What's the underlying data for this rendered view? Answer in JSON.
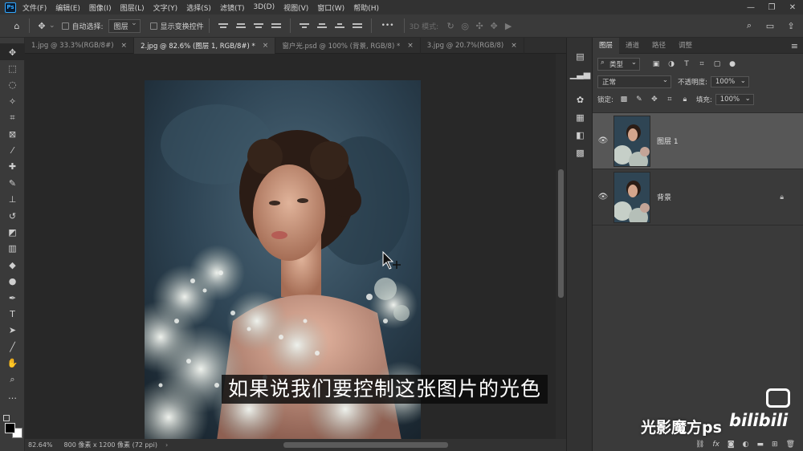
{
  "app": {
    "logo": "Ps",
    "menu": [
      "文件(F)",
      "编辑(E)",
      "图像(I)",
      "图层(L)",
      "文字(Y)",
      "选择(S)",
      "滤镜(T)",
      "3D(D)",
      "视图(V)",
      "窗口(W)",
      "帮助(H)"
    ],
    "window_controls": [
      "minimize-icon",
      "restore-icon",
      "close-icon"
    ]
  },
  "options": {
    "auto_select_label": "自动选择:",
    "auto_select_value": "图层",
    "show_transform_label": "显示变换控件",
    "more": "•••",
    "mode_3d_label": "3D 模式:"
  },
  "tabs": [
    {
      "label": "1.jpg @ 33.3%(RGB/8#)",
      "active": false
    },
    {
      "label": "2.jpg @ 82.6% (图层 1, RGB/8#) *",
      "active": true
    },
    {
      "label": "窗户光.psd @ 100% (背景, RGB/8) *",
      "active": false
    },
    {
      "label": "3.jpg @ 20.7%(RGB/8)",
      "active": false
    }
  ],
  "tabs_close": "×",
  "status": {
    "zoom": "82.64%",
    "info": "800 像素 x 1200 像素 (72 ppi)",
    "arrow": "›"
  },
  "subtitle": "如果说我们要控制这张图片的光色",
  "layers_panel": {
    "tabs": [
      "图层",
      "通道",
      "路径",
      "调整"
    ],
    "filter_kind": "类型",
    "blend_mode": "正常",
    "opacity_label": "不透明度:",
    "opacity_value": "100%",
    "lock_label": "锁定:",
    "fill_label": "填充:",
    "fill_value": "100%",
    "layers": [
      {
        "name": "图层 1",
        "selected": true,
        "visible": true,
        "locked": false
      },
      {
        "name": "背景",
        "selected": false,
        "visible": true,
        "locked": true
      }
    ],
    "footer_icons": [
      "link-icon",
      "fx-icon",
      "mask-icon",
      "adjustment-icon",
      "group-icon",
      "new-layer-icon",
      "trash-icon"
    ]
  },
  "watermark": {
    "text": "光影魔方ps",
    "brand": "bilibili"
  },
  "colors": {
    "accent": "#31a8ff",
    "panel": "#3a3a3a",
    "canvas": "#282828"
  }
}
